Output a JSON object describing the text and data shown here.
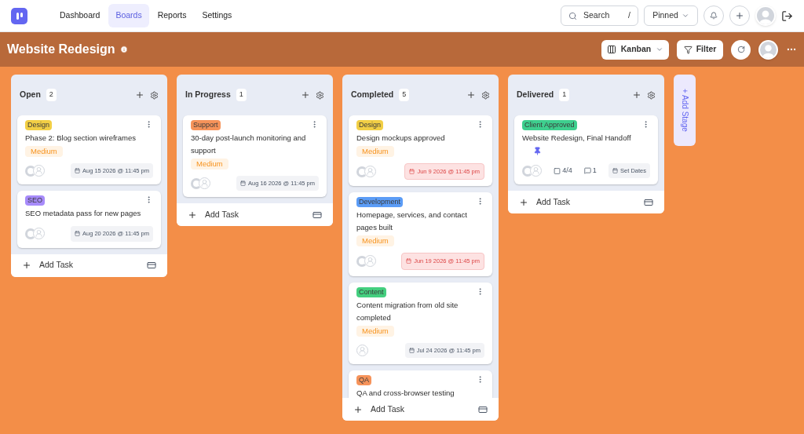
{
  "nav": {
    "items": [
      {
        "label": "Dashboard",
        "selected": false
      },
      {
        "label": "Boards",
        "selected": true
      },
      {
        "label": "Reports",
        "selected": false
      },
      {
        "label": "Settings",
        "selected": false
      }
    ]
  },
  "search": {
    "placeholder": "Search",
    "shortcut": "/"
  },
  "pinned": "Pinned",
  "board": {
    "title": "Website Redesign",
    "view": "Kanban",
    "filter": "Filter"
  },
  "columns": [
    {
      "name": "Open",
      "count": "2",
      "add_task": "Add Task",
      "cards": [
        {
          "tag": {
            "label": "Design",
            "color": "#f2cf45"
          },
          "title": "Phase 2: Blog section wireframes",
          "priority": "Medium",
          "assigned": true,
          "date": "Aug 15 2026 @ 11:45 pm",
          "overdue": false
        },
        {
          "tag": {
            "label": "SEO",
            "color": "#a78bfa"
          },
          "title": "SEO metadata pass for new pages",
          "assigned": true,
          "date": "Aug 20 2026 @ 11:45 pm",
          "overdue": false
        }
      ]
    },
    {
      "name": "In Progress",
      "count": "1",
      "add_task": "Add Task",
      "cards": [
        {
          "tag": {
            "label": "Support",
            "color": "#f6935a"
          },
          "title": "30-day post-launch monitoring and support",
          "priority": "Medium",
          "assigned": true,
          "date": "Aug 16 2026 @ 11:45 pm",
          "overdue": false
        }
      ]
    },
    {
      "name": "Completed",
      "count": "5",
      "add_task": "Add Task",
      "cards": [
        {
          "tag": {
            "label": "Design",
            "color": "#f2cf45"
          },
          "title": "Design mockups approved",
          "priority": "Medium",
          "assigned": true,
          "date": "Jun 9 2026 @ 11:45 pm",
          "overdue": true
        },
        {
          "tag": {
            "label": "Development",
            "color": "#5b9cf6"
          },
          "title": "Homepage, services, and contact pages built",
          "priority": "Medium",
          "assigned": true,
          "date": "Jun 19 2026 @ 11:45 pm",
          "overdue": true
        },
        {
          "tag": {
            "label": "Content",
            "color": "#44cf7f"
          },
          "title": "Content migration from old site completed",
          "priority": "Medium",
          "assigned": false,
          "date": "Jul 24 2026 @ 11:45 pm",
          "overdue": false
        },
        {
          "tag": {
            "label": "QA",
            "color": "#f6935a"
          },
          "title": "QA and cross-browser testing"
        }
      ]
    },
    {
      "name": "Delivered",
      "count": "1",
      "add_task": "Add Task",
      "cards": [
        {
          "tag": {
            "label": "Client Approved",
            "color": "#3ecf8e"
          },
          "title": "Website Redesign, Final Handoff",
          "pinned": true,
          "assigned": true,
          "checklist": "4/4",
          "comments": "1",
          "date": "Set Dates",
          "overdue": false
        }
      ]
    }
  ],
  "add_stage": "+ Add Stage"
}
